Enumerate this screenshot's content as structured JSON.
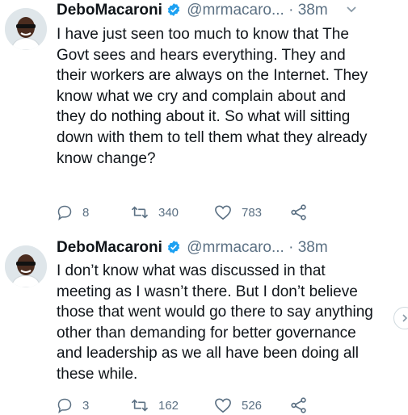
{
  "tweets": [
    {
      "display_name": "DeboMacaroni",
      "handle": "@mrmacaro...",
      "time": "· 38m",
      "text": "I have just seen too much to know that The Govt sees and hears everything. They and their workers are always on the Internet. They know what we cry and complain about and they do nothing about it. So what will sitting down with them to tell them what they already know change?",
      "replies": "8",
      "retweets": "340",
      "likes": "783"
    },
    {
      "display_name": "DeboMacaroni",
      "handle": "@mrmacaro...",
      "time": "· 38m",
      "text": "I don’t know what was discussed in that meeting as I wasn’t there. But I don’t believe those that went would go there to say anything other than demanding for better governance and leadership as we all have been doing all these while.",
      "replies": "3",
      "retweets": "162",
      "likes": "526"
    }
  ],
  "icons": {
    "verified": "verified-badge-icon",
    "caret": "chevron-down-icon",
    "reply": "reply-icon",
    "retweet": "retweet-icon",
    "like": "heart-icon",
    "share": "share-icon",
    "next": "chevron-right-icon"
  },
  "colors": {
    "verified": "#1da1f2",
    "muted": "#5b7083",
    "text": "#0f1419"
  }
}
